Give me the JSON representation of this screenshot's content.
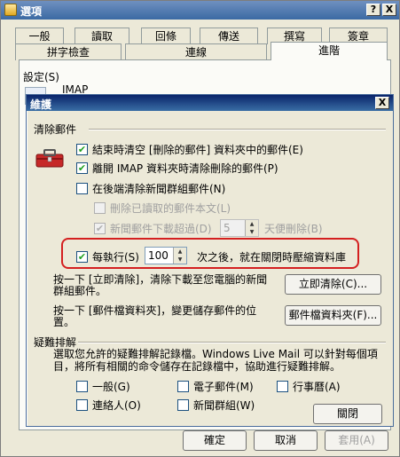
{
  "outer_window": {
    "title": "選項",
    "title_buttons": {
      "help": "?",
      "close": "X"
    },
    "tabs_row1": [
      "一般",
      "讀取",
      "回條",
      "傳送",
      "撰寫",
      "簽章"
    ],
    "tabs_row2": [
      "拼字檢查",
      "連線",
      "進階"
    ],
    "active_tab": "進階",
    "settings_label": "設定(S)",
    "imap_label": "IMAP",
    "bottom_buttons": {
      "ok": "確定",
      "cancel": "取消",
      "apply": "套用(A)"
    }
  },
  "dialog": {
    "title": "維護",
    "close_button": "X",
    "clean_group_label": "清除郵件",
    "options": [
      {
        "label": "結束時清空 [刪除的郵件] 資料夾中的郵件(E)",
        "checked": true,
        "enabled": true
      },
      {
        "label": "離開 IMAP 資料夾時清除刪除的郵件(P)",
        "checked": true,
        "enabled": true
      },
      {
        "label": "在後端清除新聞群組郵件(N)",
        "checked": false,
        "enabled": true
      },
      {
        "label": "刪除已讀取的郵件本文(L)",
        "checked": false,
        "enabled": false
      }
    ],
    "news_delete": {
      "label_prefix": "新聞郵件下載超過(D)",
      "value": "5",
      "label_suffix": "天便刪除(B)",
      "checked": true,
      "enabled": false
    },
    "compact": {
      "label_prefix": "每執行(S)",
      "value": "100",
      "label_suffix": "次之後，就在關閉時壓縮資料庫",
      "checked": true
    },
    "clean_now_text": "按一下 [立即清除]，清除下載至您電腦的新聞群組郵件。",
    "clean_now_button": "立即清除(C)...",
    "store_text": "按一下 [郵件檔資料夾]，變更儲存郵件的位置。",
    "store_button": "郵件檔資料夾(F)...",
    "troubleshoot_label": "疑難排解",
    "troubleshoot_text": "選取您允許的疑難排解記錄檔。Windows Live Mail 可以針對每個項目，將所有相關的命令儲存在記錄檔中，協助進行疑難排解。",
    "logs": [
      {
        "label": "一般(G)",
        "checked": false
      },
      {
        "label": "電子郵件(M)",
        "checked": false
      },
      {
        "label": "行事曆(A)",
        "checked": false
      },
      {
        "label": "連絡人(O)",
        "checked": false
      },
      {
        "label": "新聞群組(W)",
        "checked": false
      }
    ],
    "close_dialog_button": "關閉"
  },
  "colors": {
    "highlight": "#d42020",
    "title_blue": "#0a246a",
    "check_green": "#21a121"
  },
  "icons": [
    "mail-options-icon",
    "imap-icon",
    "toolbox-icon",
    "check-icon"
  ]
}
